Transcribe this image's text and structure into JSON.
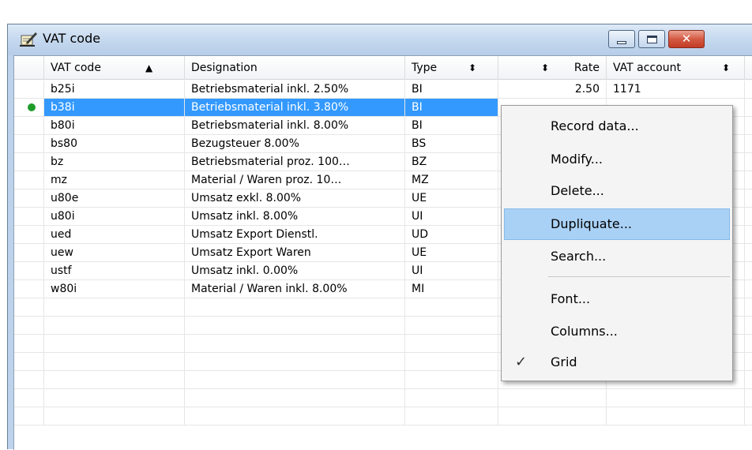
{
  "window": {
    "title": "VAT code",
    "icon": "vat-document-pencil-icon",
    "close_glyph": "✕"
  },
  "columns": [
    {
      "label": "VAT code",
      "indicator": "▲"
    },
    {
      "label": "Designation",
      "indicator": ""
    },
    {
      "label": "Type",
      "indicator": "⬍"
    },
    {
      "label": "Rate",
      "indicator": "⬍"
    },
    {
      "label": "VAT account",
      "indicator": "⬍"
    }
  ],
  "rows": [
    {
      "code": "b25i",
      "designation": "Betriebsmaterial inkl. 2.50%",
      "type": "BI",
      "rate": "2.50",
      "account": "1171",
      "selected": false
    },
    {
      "code": "b38i",
      "designation": "Betriebsmaterial inkl. 3.80%",
      "type": "BI",
      "rate": "",
      "account": "",
      "selected": true
    },
    {
      "code": "b80i",
      "designation": "Betriebsmaterial inkl. 8.00%",
      "type": "BI",
      "rate": "",
      "account": "",
      "selected": false
    },
    {
      "code": "bs80",
      "designation": "Bezugsteuer 8.00%",
      "type": "BS",
      "rate": "",
      "account": "",
      "selected": false
    },
    {
      "code": "bz",
      "designation": "Betriebsmaterial proz. 100…",
      "type": "BZ",
      "rate": "",
      "account": "",
      "selected": false
    },
    {
      "code": "mz",
      "designation": "Material / Waren proz. 10…",
      "type": "MZ",
      "rate": "",
      "account": "",
      "selected": false
    },
    {
      "code": "u80e",
      "designation": "Umsatz exkl. 8.00%",
      "type": "UE",
      "rate": "",
      "account": "",
      "selected": false
    },
    {
      "code": "u80i",
      "designation": "Umsatz inkl. 8.00%",
      "type": "UI",
      "rate": "",
      "account": "",
      "selected": false
    },
    {
      "code": "ued",
      "designation": "Umsatz Export Dienstl.",
      "type": "UD",
      "rate": "",
      "account": "",
      "selected": false
    },
    {
      "code": "uew",
      "designation": "Umsatz Export Waren",
      "type": "UE",
      "rate": "",
      "account": "",
      "selected": false
    },
    {
      "code": "ustf",
      "designation": "Umsatz inkl. 0.00%",
      "type": "UI",
      "rate": "",
      "account": "",
      "selected": false
    },
    {
      "code": "w80i",
      "designation": "Material / Waren inkl. 8.00%",
      "type": "MI",
      "rate": "",
      "account": "",
      "selected": false
    }
  ],
  "empty_rows": 7,
  "context_menu": {
    "items": [
      {
        "label": "Record data...",
        "hovered": false,
        "checked": false
      },
      {
        "label": "Modify...",
        "hovered": false,
        "checked": false
      },
      {
        "label": "Delete...",
        "hovered": false,
        "checked": false
      },
      {
        "label": "Dupliquate...",
        "hovered": true,
        "checked": false
      },
      {
        "label": "Search...",
        "hovered": false,
        "checked": false
      },
      {
        "label": "Font...",
        "hovered": false,
        "checked": false
      },
      {
        "label": "Columns...",
        "hovered": false,
        "checked": false
      },
      {
        "label": "Grid",
        "hovered": false,
        "checked": true
      }
    ],
    "check_glyph": "✓"
  },
  "colors": {
    "selection": "#3399ff",
    "menu_hover": "#a9d1f5",
    "active_dot": "#1e9c2a"
  }
}
